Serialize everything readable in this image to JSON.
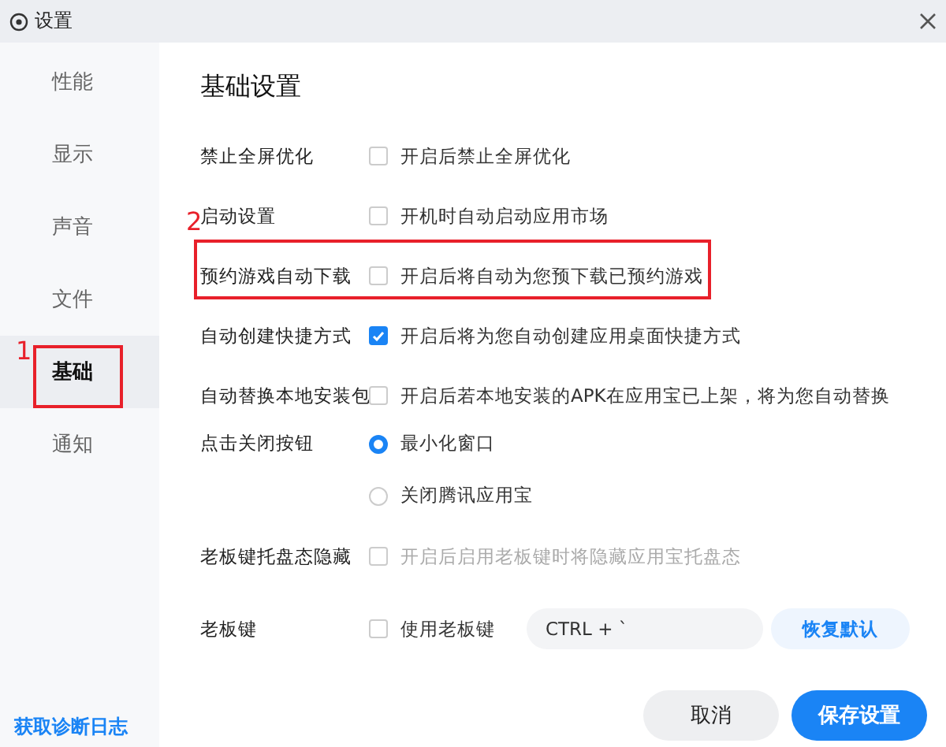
{
  "window": {
    "title": "设置"
  },
  "sidebar": {
    "items": [
      {
        "label": "性能",
        "selected": false
      },
      {
        "label": "显示",
        "selected": false
      },
      {
        "label": "声音",
        "selected": false
      },
      {
        "label": "文件",
        "selected": false
      },
      {
        "label": "基础",
        "selected": true,
        "annotation": "1"
      },
      {
        "label": "通知",
        "selected": false
      }
    ],
    "footer_link": "获取诊断日志"
  },
  "content": {
    "heading": "基础设置",
    "rows": [
      {
        "kind": "checkbox",
        "label": "禁止全屏优化",
        "text": "开启后禁止全屏优化",
        "checked": false,
        "disabled": false
      },
      {
        "kind": "checkbox",
        "label": "启动设置",
        "text": "开机时自动启动应用市场",
        "checked": false,
        "disabled": false
      },
      {
        "kind": "checkbox",
        "label": "预约游戏自动下载",
        "text": "开启后将自动为您预下载已预约游戏",
        "checked": false,
        "disabled": false,
        "annotation": "2"
      },
      {
        "kind": "checkbox",
        "label": "自动创建快捷方式",
        "text": "开启后将为您自动创建应用桌面快捷方式",
        "checked": true,
        "disabled": false
      },
      {
        "kind": "checkbox",
        "label": "自动替换本地安装包",
        "text": "开启后若本地安装的APK在应用宝已上架，将为您自动替换",
        "checked": false,
        "disabled": false
      },
      {
        "kind": "radio",
        "label": "点击关闭按钮",
        "options": [
          {
            "label": "最小化窗口",
            "selected": true
          },
          {
            "label": "关闭腾讯应用宝",
            "selected": false
          }
        ]
      },
      {
        "kind": "checkbox",
        "label": "老板键托盘态隐藏",
        "text": "开启后启用老板键时将隐藏应用宝托盘态",
        "checked": false,
        "disabled": true
      },
      {
        "kind": "hotkey",
        "label": "老板键",
        "text": "使用老板键",
        "checked": false,
        "value": "CTRL + `",
        "reset": "恢复默认"
      }
    ]
  },
  "buttons": [
    {
      "label": "取消",
      "kind": "secondary"
    },
    {
      "label": "保存设置",
      "kind": "primary"
    }
  ]
}
